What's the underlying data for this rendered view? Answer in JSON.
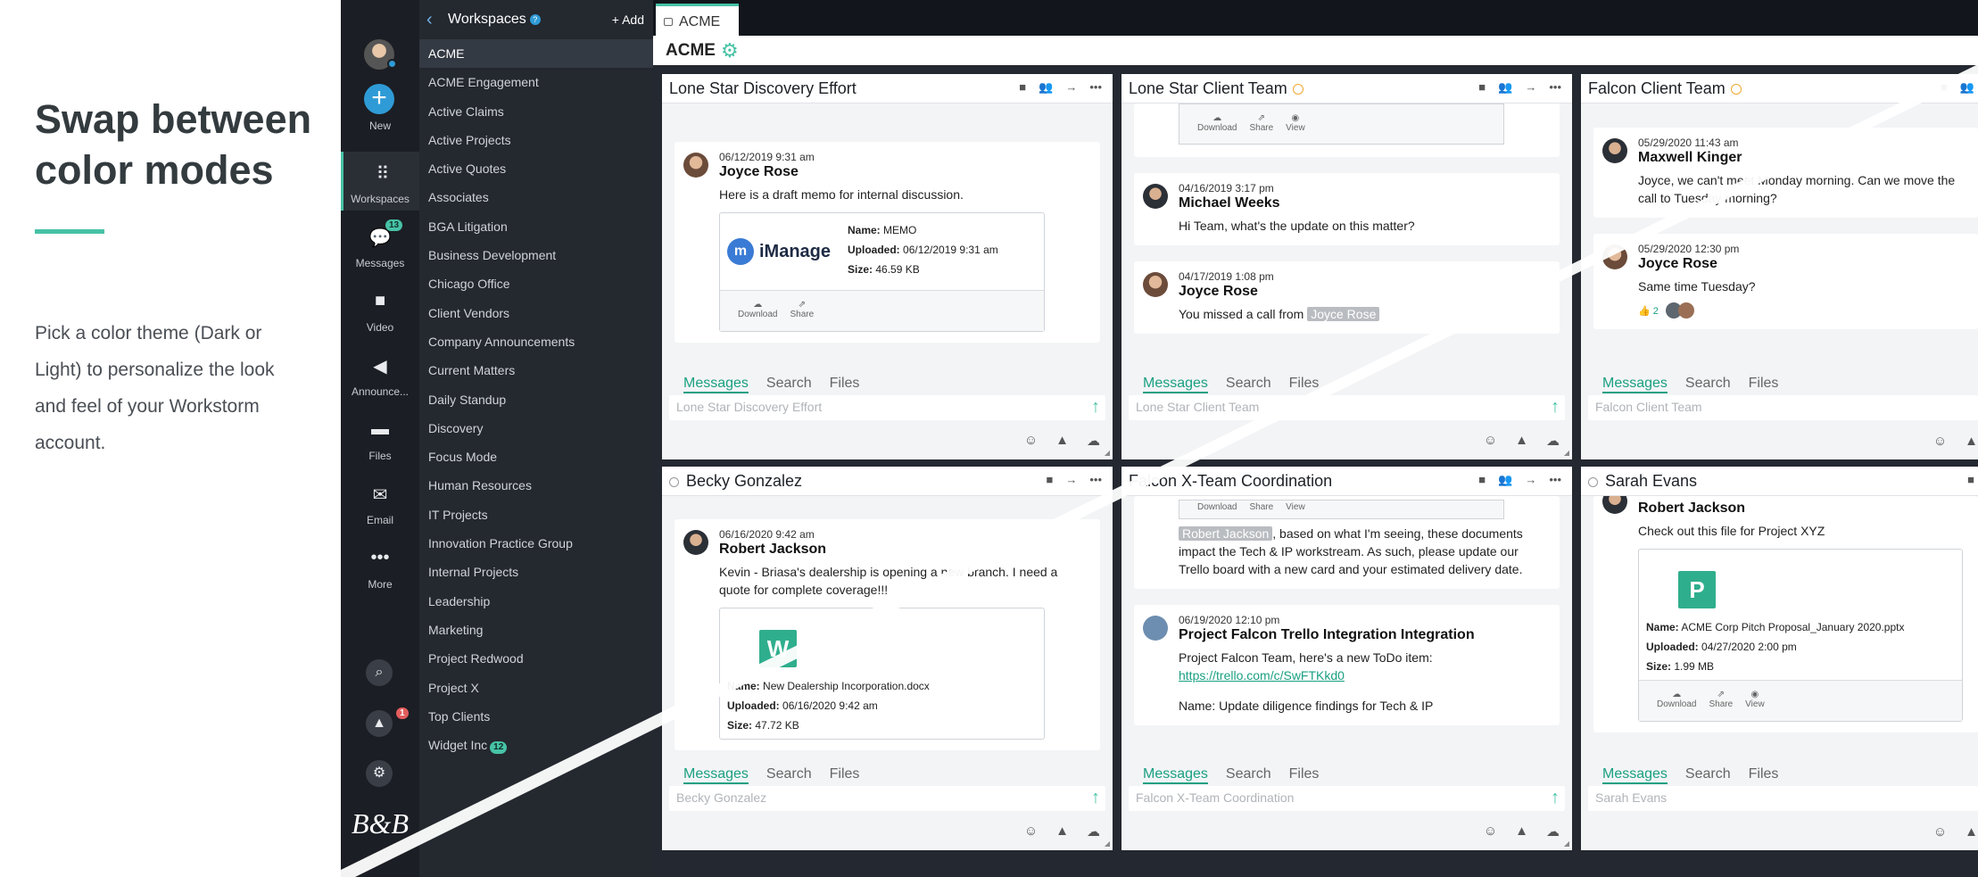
{
  "promo": {
    "title": "Swap between color modes",
    "body": "Pick a color theme (Dark or Light) to personalize the look and feel of your Workstorm account."
  },
  "rail": {
    "new_label": "New",
    "workspaces_label": "Workspaces",
    "messages_label": "Messages",
    "messages_badge": "13",
    "video_label": "Video",
    "announcements_label": "Announce...",
    "files_label": "Files",
    "email_label": "Email",
    "more_label": "More",
    "alerts_badge": "1",
    "logo_text": "B&B"
  },
  "workspaces": {
    "title": "Workspaces",
    "help": "?",
    "add_label": "+ Add",
    "items": [
      "ACME",
      "ACME Engagement",
      "Active Claims",
      "Active Projects",
      "Active Quotes",
      "Associates",
      "BGA Litigation",
      "Business Development",
      "Chicago Office",
      "Client Vendors",
      "Company Announcements",
      "Current Matters",
      "Daily Standup",
      "Discovery",
      "Focus Mode",
      "Human Resources",
      "IT Projects",
      "Innovation Practice Group",
      "Internal Projects",
      "Leadership",
      "Marketing",
      "Project Redwood",
      "Project X",
      "Top Clients",
      "Widget Inc"
    ],
    "widget_count": "12"
  },
  "tab": {
    "label": "ACME"
  },
  "crumb": {
    "title": "ACME"
  },
  "tabs": {
    "messages": "Messages",
    "search": "Search",
    "files": "Files"
  },
  "actions": {
    "download": "Download",
    "share": "Share",
    "view": "View"
  },
  "panels": {
    "p1": {
      "title": "Lone Star Discovery Effort",
      "placeholder": "Lone Star Discovery Effort",
      "m1_time": "06/12/2019 9:31 am",
      "m1_name": "Joyce Rose",
      "m1_text": "Here is a draft memo for internal discussion.",
      "att_brand": "iManage",
      "att_name": "MEMO",
      "att_uploaded": "06/12/2019 9:31 am",
      "att_size": "46.59 KB"
    },
    "p2": {
      "title": "Lone Star Client Team",
      "placeholder": "Lone Star Client Team",
      "m1_time": "04/16/2019 3:17 pm",
      "m1_name": "Michael Weeks",
      "m1_text": "Hi Team, what's the update on this matter?",
      "m2_time": "04/17/2019 1:08 pm",
      "m2_name": "Joyce Rose",
      "m2_text": "You missed a call from",
      "m2_mention": "Joyce Rose"
    },
    "p3": {
      "title": "Falcon Client Team",
      "placeholder": "Falcon Client Team",
      "m1_time": "05/29/2020 11:43 am",
      "m1_name": "Maxwell Kinger",
      "m1_text": "Joyce, we can't meet Monday morning. Can we move the call to Tuesday morning?",
      "m2_time": "05/29/2020 12:30 pm",
      "m2_name": "Joyce Rose",
      "m2_text": "Same time Tuesday?",
      "reaction_count": "2"
    },
    "p4": {
      "title": "Becky Gonzalez",
      "placeholder": "Becky Gonzalez",
      "m1_time": "06/16/2020 9:42 am",
      "m1_name": "Robert Jackson",
      "m1_text": "Kevin - Briasa's dealership is opening a new branch. I need a quote for complete coverage!!!",
      "att_letter": "W",
      "att_name": "New Dealership Incorporation.docx",
      "att_uploaded": "06/16/2020 9:42 am",
      "att_size": "47.72 KB"
    },
    "p5": {
      "title": "Falcon X-Team Coordination",
      "placeholder": "Falcon X-Team Coordination",
      "m1_mention": "Robert Jackson",
      "m1_text": ", based on what I'm seeing, these documents impact the Tech & IP workstream. As such, please update our Trello board with a new card and your estimated delivery date.",
      "m2_time": "06/19/2020 12:10 pm",
      "m2_name": "Project Falcon Trello Integration Integration",
      "m2_text": "Project Falcon Team, here's a new ToDo item:",
      "m2_link": "https://trello.com/c/SwFTKkd0",
      "m2_text2": "Name: Update diligence findings for Tech & IP"
    },
    "p6": {
      "title": "Sarah Evans",
      "placeholder": "Sarah Evans",
      "m1_name": "Robert Jackson",
      "m1_text": "Check out this file for Project XYZ",
      "att_letter": "P",
      "att_name": "ACME Corp Pitch Proposal_January 2020.pptx",
      "att_uploaded": "04/27/2020 2:00 pm",
      "att_size": "1.99 MB"
    }
  },
  "labels": {
    "name": "Name:",
    "uploaded": "Uploaded:",
    "size": "Size:"
  },
  "colors": {
    "accent": "#47c2a6",
    "rail": "#1b1e24",
    "list": "#24282f",
    "link_blue": "#2f9bd6"
  }
}
